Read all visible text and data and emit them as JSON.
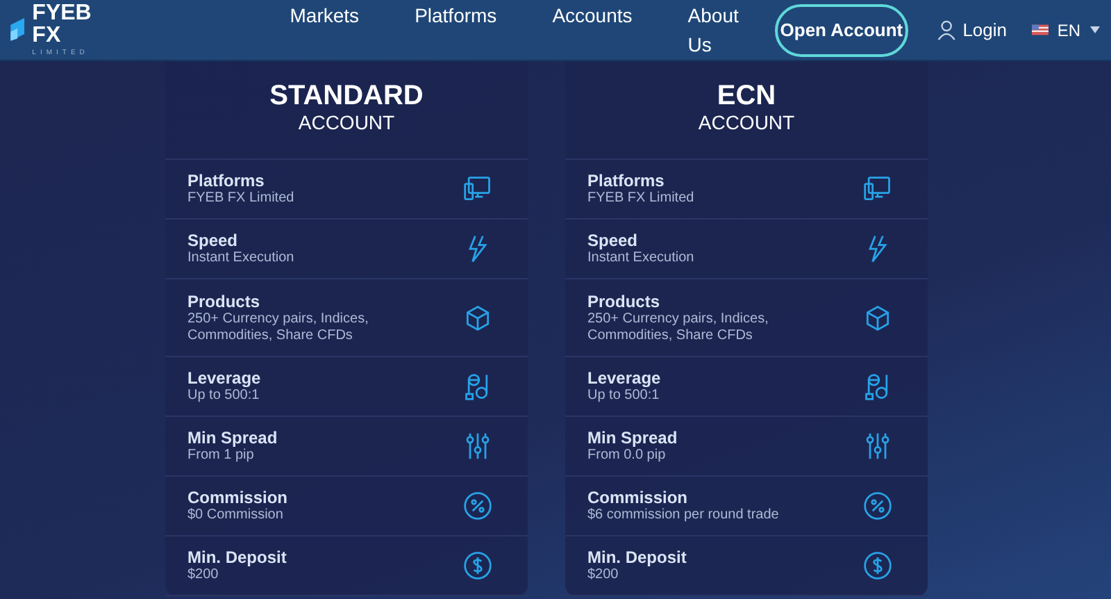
{
  "header": {
    "logo": {
      "name": "FYEB FX",
      "tagline": "LIMITED"
    },
    "nav": [
      "Markets",
      "Platforms",
      "Accounts",
      "About Us"
    ],
    "cta": "Open Account",
    "login": "Login",
    "language": "EN"
  },
  "accounts": [
    {
      "title": "STANDARD",
      "subtitle": "ACCOUNT",
      "features": [
        {
          "label": "Platforms",
          "value": "FYEB FX Limited"
        },
        {
          "label": "Speed",
          "value": "Instant Execution"
        },
        {
          "label": "Products",
          "value": "250+ Currency pairs, Indices, Commodities, Share CFDs"
        },
        {
          "label": "Leverage",
          "value": "Up to 500:1"
        },
        {
          "label": "Min Spread",
          "value": "From 1 pip"
        },
        {
          "label": "Commission",
          "value": "$0 Commission"
        },
        {
          "label": "Min. Deposit",
          "value": "$200"
        }
      ]
    },
    {
      "title": "ECN",
      "subtitle": "ACCOUNT",
      "features": [
        {
          "label": "Platforms",
          "value": "FYEB FX Limited"
        },
        {
          "label": "Speed",
          "value": "Instant Execution"
        },
        {
          "label": "Products",
          "value": "250+ Currency pairs, Indices, Commodities, Share CFDs"
        },
        {
          "label": "Leverage",
          "value": "Up to 500:1"
        },
        {
          "label": "Min Spread",
          "value": "From 0.0 pip"
        },
        {
          "label": "Commission",
          "value": "$6 commission per round trade"
        },
        {
          "label": "Min. Deposit",
          "value": "$200"
        }
      ]
    }
  ]
}
